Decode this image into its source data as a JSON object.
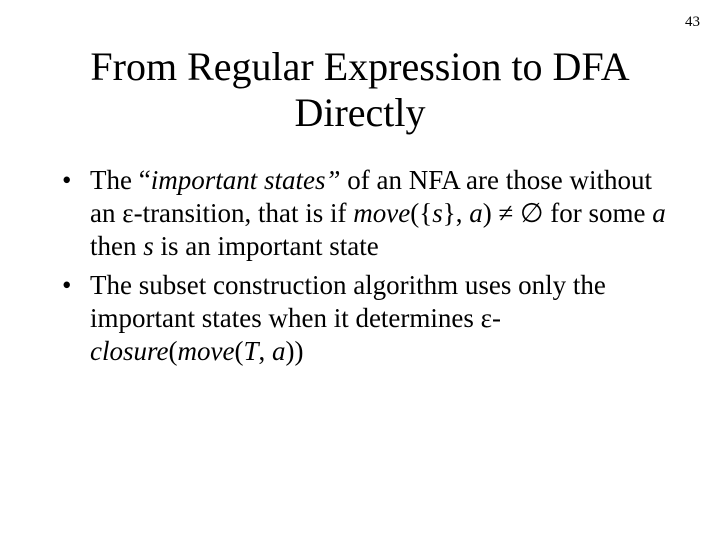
{
  "page_number": "43",
  "title": "From Regular Expression to DFA Directly",
  "bullets": [
    {
      "pre": "The ",
      "quote_open": "“",
      "em": "important states”",
      "mid1": " of an NFA are those without an ε-transition, that is if ",
      "move_em": "move",
      "move_args": "({",
      "s_em": "s",
      "move_args2": "}, ",
      "a_em": "a",
      "move_close": ") ≠ ∅ for some ",
      "a2_em": "a",
      "mid2": " then ",
      "s2_em": "s",
      "tail": " is an important state"
    },
    {
      "pre": "The subset construction algorithm uses only the important states when it determines ε-",
      "closure_em": "closure",
      "open_paren": "(",
      "move_em": "move",
      "open2": "(",
      "T_em": "T",
      "comma": ", ",
      "a_em": "a",
      "close": "))"
    }
  ]
}
